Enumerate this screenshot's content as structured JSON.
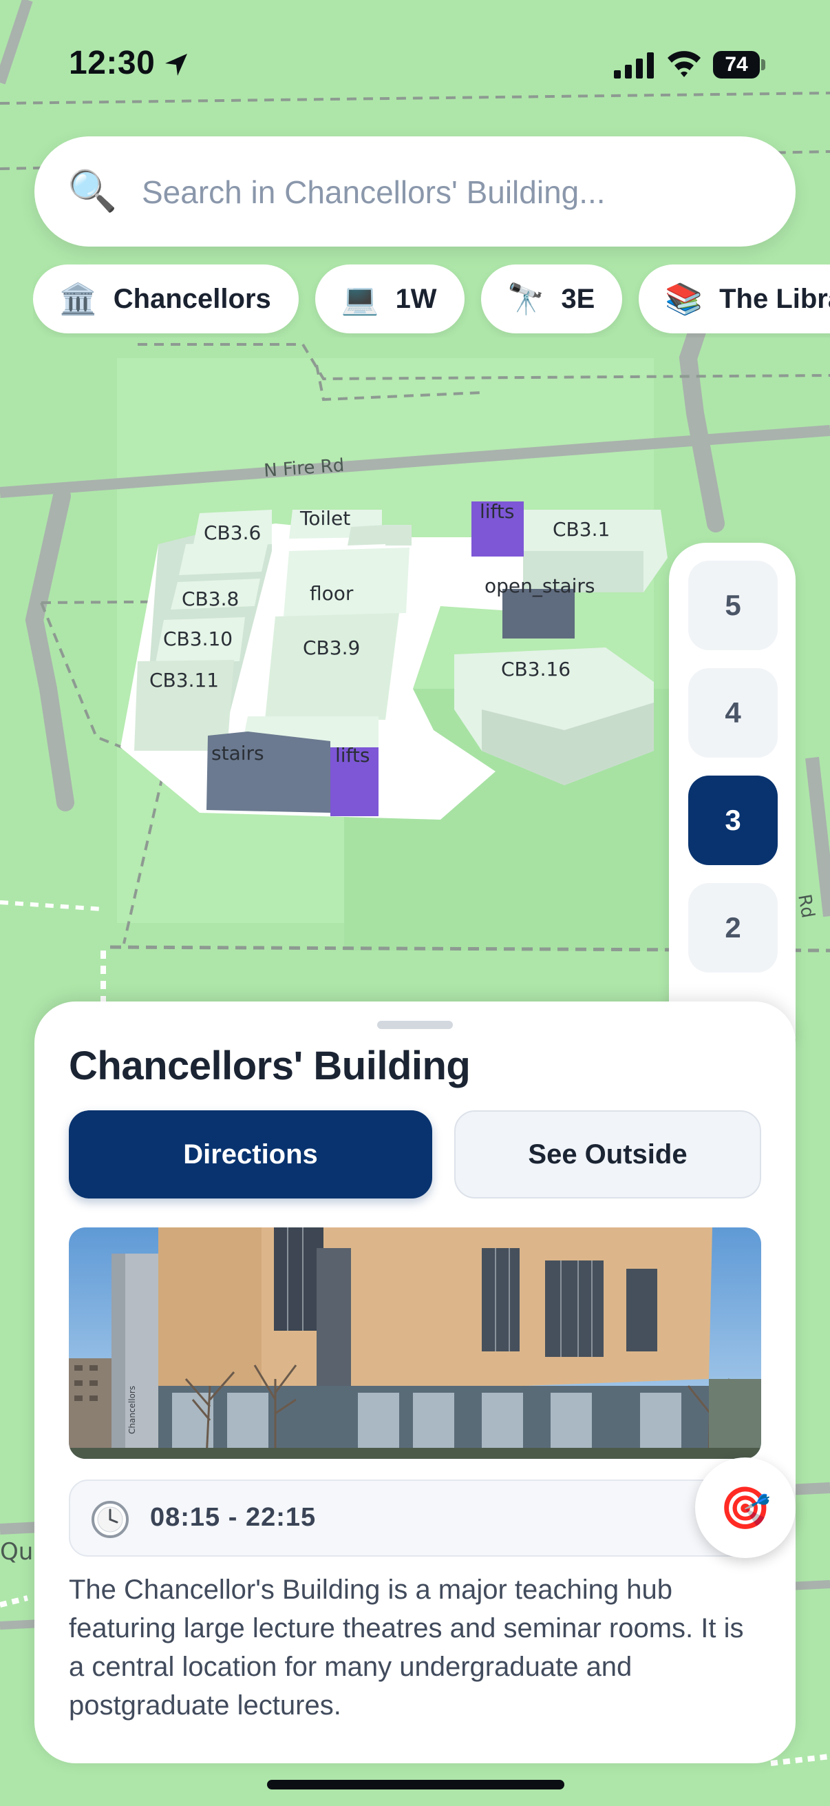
{
  "status_bar": {
    "time": "12:30",
    "battery": "74"
  },
  "search": {
    "placeholder": "Search in Chancellors' Building...",
    "icon": "magnifier"
  },
  "chips": [
    {
      "icon": "🏛️",
      "label": "Chancellors"
    },
    {
      "icon": "💻",
      "label": "1W"
    },
    {
      "icon": "🔭",
      "label": "3E"
    },
    {
      "icon": "📚",
      "label": "The Library"
    }
  ],
  "map": {
    "road_labels": {
      "n_fire_rd": "N Fire Rd",
      "edge_rd": "Rd",
      "edge_qu": "Qu"
    },
    "rooms": {
      "cb36": "CB3.6",
      "toilet": "Toilet",
      "lifts_north": "lifts",
      "cb31": "CB3.1",
      "cb38": "CB3.8",
      "floor": "floor",
      "open_stairs": "open_stairs",
      "cb310": "CB3.10",
      "cb39": "CB3.9",
      "cb316": "CB3.16",
      "cb311": "CB3.11",
      "stairs": "stairs",
      "lifts_south": "lifts"
    },
    "colors": {
      "background": "#aee6a9",
      "room": "#e3f3e6",
      "stairs": "#6b7a90",
      "lifts": "#7d57d6"
    }
  },
  "floors": {
    "items": [
      "5",
      "4",
      "3",
      "2"
    ],
    "selected": "3"
  },
  "sheet": {
    "title": "Chancellors' Building",
    "directions_label": "Directions",
    "see_outside_label": "See Outside",
    "hours": "08:15 - 22:15",
    "description": "The Chancellor's Building is a major teaching hub featuring large lecture theatres and seminar rooms. It is a central location for many undergraduate and postgraduate lectures.",
    "photo_sign": "Chancellors"
  },
  "locate": {
    "icon": "🎯"
  },
  "accent_color": "#08336f"
}
